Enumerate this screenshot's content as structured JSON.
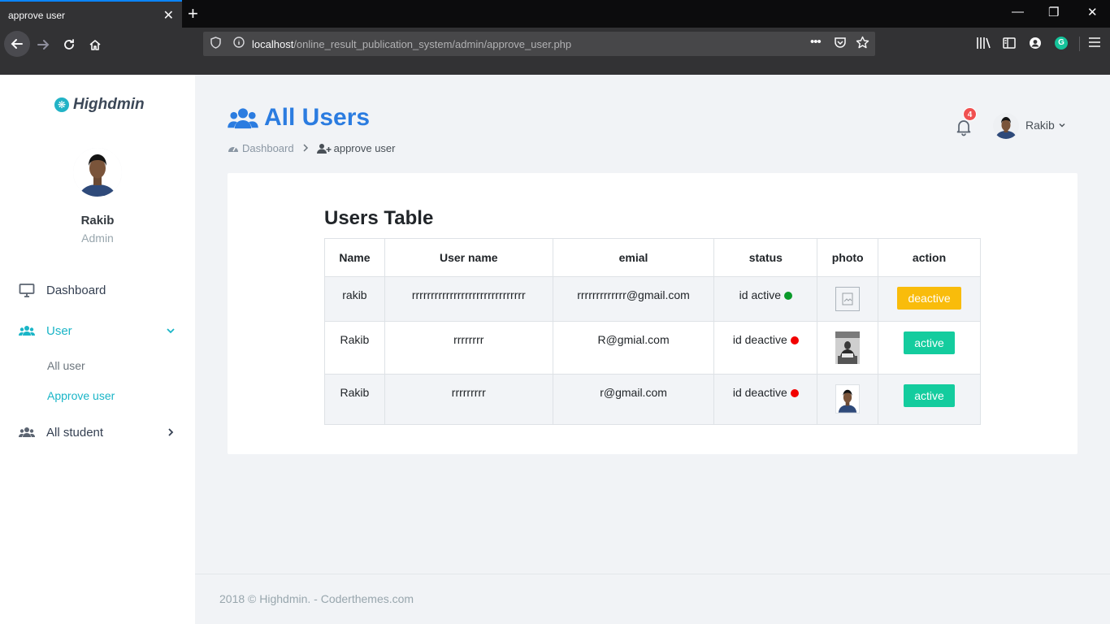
{
  "browser": {
    "tab_title": "approve user",
    "tab_close": "✕",
    "new_tab": "+",
    "url_host": "localhost",
    "url_path": "/online_result_publication_system/admin/approve_user.php",
    "page_actions": "•••"
  },
  "sidebar": {
    "logo_text": "Highdmin",
    "profile_name": "Rakib",
    "profile_role": "Admin",
    "menu": {
      "dashboard": "Dashboard",
      "user": "User",
      "all_user": "All user",
      "approve_user": "Approve user",
      "all_student": "All student"
    }
  },
  "header": {
    "page_title": "All Users",
    "breadcrumb_home": "Dashboard",
    "breadcrumb_current": "approve user",
    "notification_count": "4",
    "user_name": "Rakib"
  },
  "table": {
    "title": "Users Table",
    "columns": [
      "Name",
      "User name",
      "emial",
      "status",
      "photo",
      "action"
    ],
    "rows": [
      {
        "name": "rakib",
        "username": "rrrrrrrrrrrrrrrrrrrrrrrrrrrrrr",
        "email": "rrrrrrrrrrrrr@gmail.com",
        "status": "id active",
        "status_color": "#0a9a2a",
        "action": "deactive"
      },
      {
        "name": "Rakib",
        "username": "rrrrrrrr",
        "email": "R@gmial.com",
        "status": "id deactive",
        "status_color": "#f20000",
        "action": "active"
      },
      {
        "name": "Rakib",
        "username": "rrrrrrrrr",
        "email": "r@gmail.com",
        "status": "id deactive",
        "status_color": "#f20000",
        "action": "active"
      }
    ]
  },
  "footer": {
    "text": "2018 © Highdmin. - Coderthemes.com"
  }
}
